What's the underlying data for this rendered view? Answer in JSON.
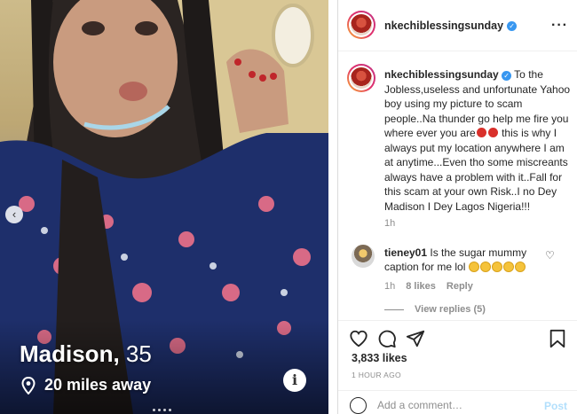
{
  "profile_card": {
    "name": "Madison,",
    "age": "35",
    "distance": "20 miles away",
    "icons": {
      "location": "location-pin-icon",
      "info": "info-icon",
      "carousel_prev": "chevron-left-icon"
    }
  },
  "post": {
    "author": {
      "username": "nkechiblessingsunday",
      "verified": true
    },
    "caption": {
      "username": "nkechiblessingsunday",
      "text_part1": " To the Jobless,useless and unfortunate Yahoo boy using my picture to scam people..Na thunder go help me fire you where ever you are",
      "text_part2": " this is why I always put my location anywhere I am at anytime...Even tho some miscreants always have a problem with it..Fall for this scam at your own Risk..I no Dey Madison I Dey Lagos Nigeria!!!",
      "time": "1h"
    },
    "comment": {
      "username": "tieney01",
      "text": " Is the sugar mummy caption for me lol ",
      "emoji_count": 5,
      "time": "1h",
      "likes": "8 likes",
      "reply_label": "Reply",
      "view_replies": "View replies (5)"
    },
    "likes": "3,833 likes",
    "time_ago": "1 HOUR AGO",
    "add_comment_placeholder": "Add a comment…",
    "post_button": "Post",
    "colors": {
      "verified": "#3897f0",
      "post_button": "#b2dffc",
      "secondary_text": "#8e8e8e"
    },
    "icons": [
      "heart-icon",
      "comment-icon",
      "share-icon",
      "bookmark-icon",
      "emoji-icon",
      "more-icon"
    ]
  }
}
